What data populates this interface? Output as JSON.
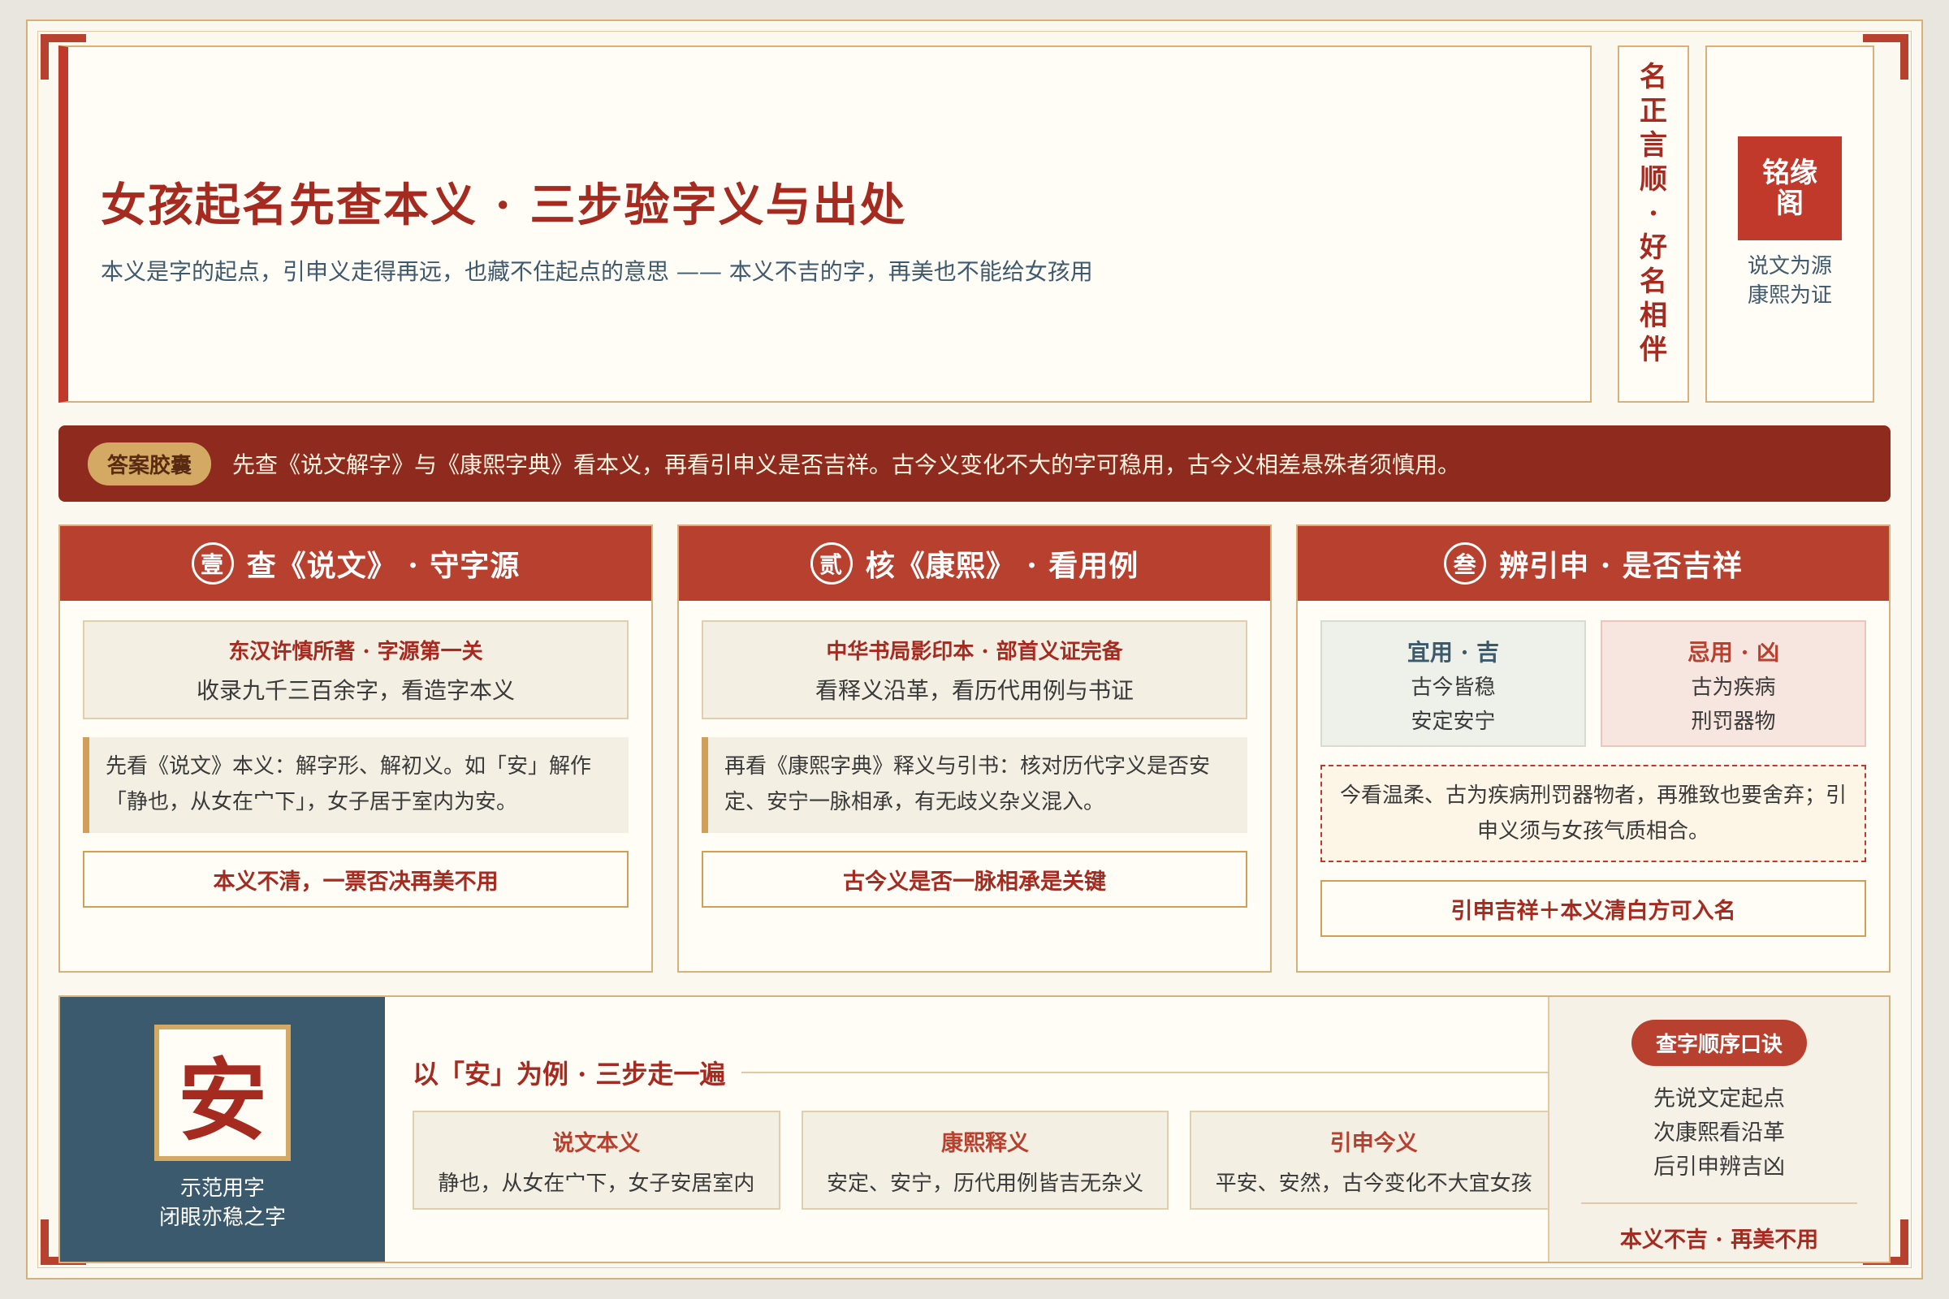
{
  "header": {
    "title": "女孩起名先查本义  ·  三步验字义与出处",
    "subtitle": "本义是字的起点，引申义走得再远，也藏不住起点的意思 —— 本义不吉的字，再美也不能给女孩用"
  },
  "vertical_motto": [
    "名",
    "正",
    "言",
    "顺",
    "·",
    "好",
    "名",
    "相",
    "伴"
  ],
  "seal": {
    "text": "铭缘阁",
    "caption_line1": "说文为源",
    "caption_line2": "康熙为证"
  },
  "answer": {
    "tag": "答案胶囊",
    "text": "先查《说文解字》与《康熙字典》看本义，再看引申义是否吉祥。古今义变化不大的字可稳用，古今义相差悬殊者须慎用。"
  },
  "cards": [
    {
      "num": "壹",
      "title": "查《说文》  ·  守字源",
      "info_title": "东汉许慎所著  ·  字源第一关",
      "info_body": "收录九千三百余字，看造字本义",
      "quote": "先看《说文》本义：解字形、解初义。如「安」解作「静也，从女在宀下」，女子居于室内为安。",
      "verdict": "本义不清，一票否决再美不用"
    },
    {
      "num": "贰",
      "title": "核《康熙》  ·  看用例",
      "info_title": "中华书局影印本  ·  部首义证完备",
      "info_body": "看释义沿革，看历代用例与书证",
      "quote": "再看《康熙字典》释义与引书：核对历代字义是否安定、安宁一脉相承，有无歧义杂义混入。",
      "verdict": "古今义是否一脉相承是关键"
    },
    {
      "num": "叁",
      "title": "辨引申  ·  是否吉祥",
      "good_label": "宜用 · 吉",
      "good_line1": "古今皆稳",
      "good_line2": "安定安宁",
      "bad_label": "忌用 · 凶",
      "bad_line1": "古为疾病",
      "bad_line2": "刑罚器物",
      "dashed": "今看温柔、古为疾病刑罚器物者，再雅致也要舍弃；引申义须与女孩气质相合。",
      "verdict": "引申吉祥＋本义清白方可入名"
    }
  ],
  "example": {
    "char": "安",
    "caption_line1": "示范用字",
    "caption_line2": "闭眼亦稳之字",
    "title": "以「安」为例  ·  三步走一遍",
    "steps": [
      {
        "title": "说文本义",
        "body": "静也，从女在宀下，女子安居室内"
      },
      {
        "title": "康熙释义",
        "body": "安定、安宁，历代用例皆吉无杂义"
      },
      {
        "title": "引申今义",
        "body": "平安、安然，古今变化不大宜女孩"
      }
    ]
  },
  "mnemonic": {
    "pill": "查字顺序口诀",
    "line1": "先说文定起点",
    "line2": "次康熙看沿革",
    "line3": "后引申辨吉凶",
    "motto": "本义不吉 · 再美不用"
  },
  "colors": {
    "accent_red": "#b8402f",
    "dark_red": "#8f2a1e",
    "gold": "#d4a964",
    "slate_blue": "#3b5a6e",
    "paper": "#fbf8ef"
  }
}
